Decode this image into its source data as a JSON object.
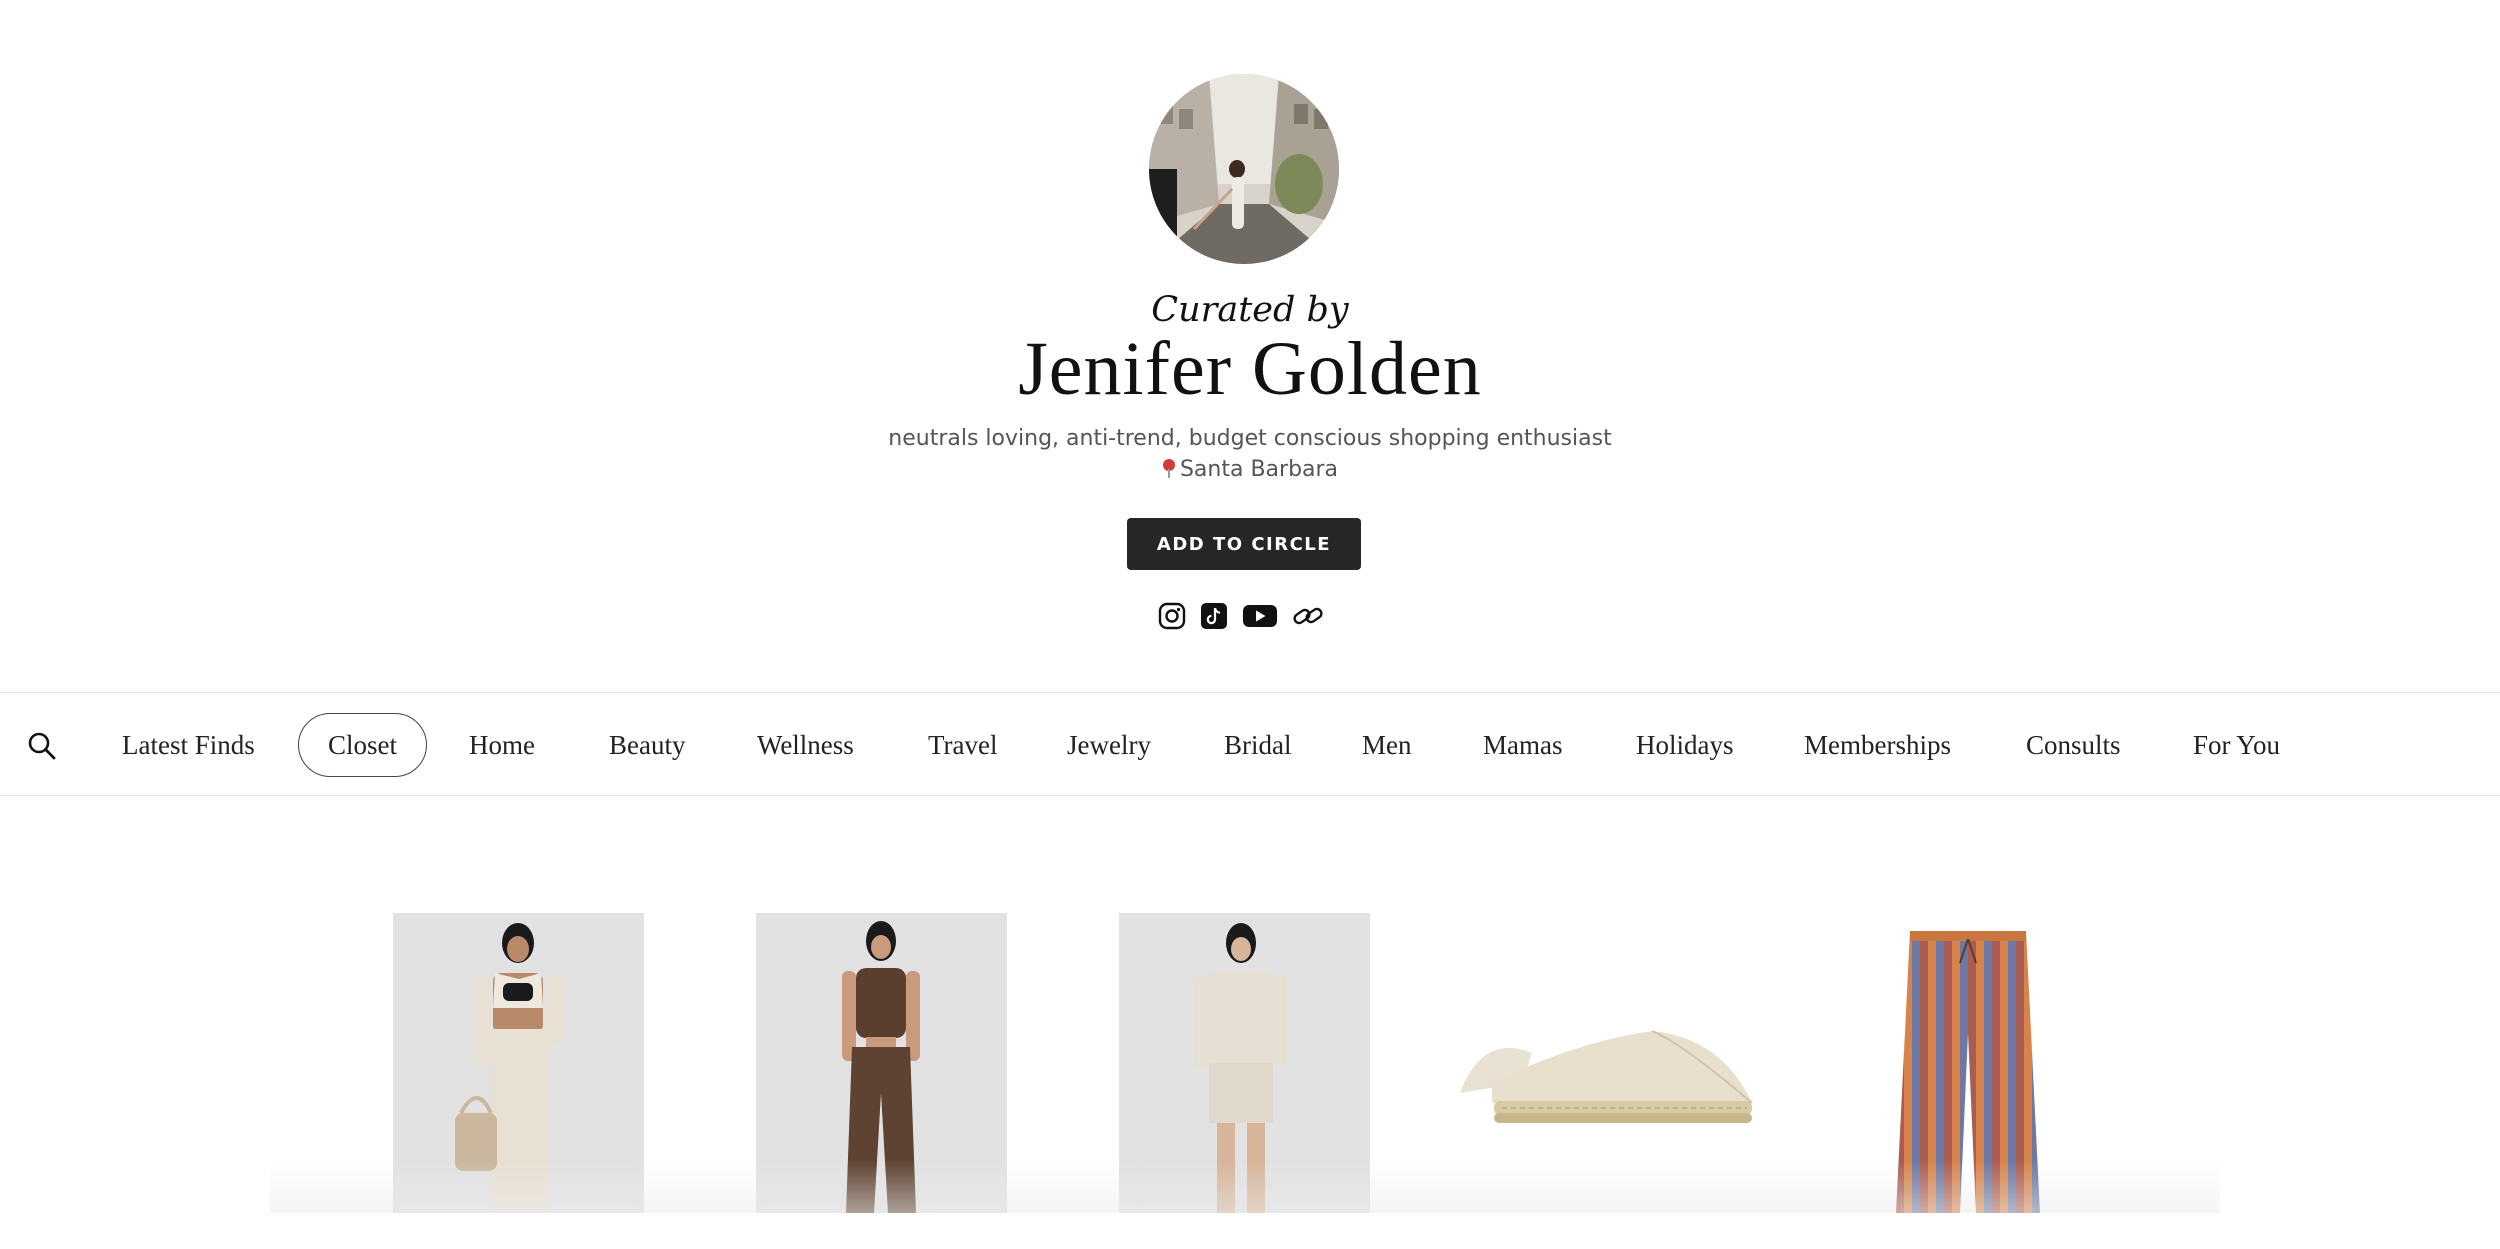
{
  "profile": {
    "curated_label": "Curated by",
    "name": "Jenifer Golden",
    "bio": "neutrals loving, anti-trend, budget conscious shopping enthusiast",
    "location": "Santa Barbara",
    "cta_label": "ADD TO CIRCLE",
    "avatar_icon": "profile-photo"
  },
  "socials": [
    {
      "name": "instagram-icon"
    },
    {
      "name": "tiktok-icon"
    },
    {
      "name": "youtube-icon"
    },
    {
      "name": "link-icon"
    }
  ],
  "nav": {
    "search_icon": "search-icon",
    "active": "Closet",
    "items": [
      {
        "label": "Latest Finds"
      },
      {
        "label": "Closet"
      },
      {
        "label": "Home"
      },
      {
        "label": "Beauty"
      },
      {
        "label": "Wellness"
      },
      {
        "label": "Travel"
      },
      {
        "label": "Jewelry"
      },
      {
        "label": "Bridal"
      },
      {
        "label": "Men"
      },
      {
        "label": "Mamas"
      },
      {
        "label": "Holidays"
      },
      {
        "label": "Memberships"
      },
      {
        "label": "Consults"
      },
      {
        "label": "For You"
      }
    ]
  },
  "products": [
    {
      "name": "product-cream-vest-set"
    },
    {
      "name": "product-brown-knit-set"
    },
    {
      "name": "product-linen-shirt-shorts"
    },
    {
      "name": "product-espadrille-flat"
    },
    {
      "name": "product-striped-pants"
    }
  ],
  "colors": {
    "cta_bg": "#262626",
    "pin": "#d33a3a",
    "active_border": "#444444"
  }
}
